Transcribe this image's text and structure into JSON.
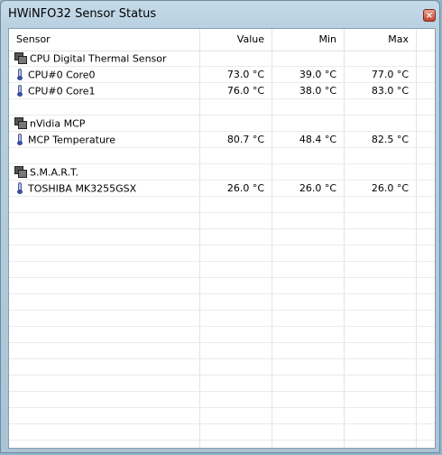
{
  "window": {
    "title": "HWiNFO32 Sensor Status",
    "close_label": "×"
  },
  "table": {
    "columns": {
      "sensor": "Sensor",
      "value": "Value",
      "min": "Min",
      "max": "Max"
    },
    "rows": [
      {
        "kind": "group",
        "label": "CPU Digital Thermal Sensor"
      },
      {
        "kind": "sensor",
        "label": "CPU#0 Core0",
        "value": "73.0 °C",
        "min": "39.0 °C",
        "max": "77.0 °C"
      },
      {
        "kind": "sensor",
        "label": "CPU#0 Core1",
        "value": "76.0 °C",
        "min": "38.0 °C",
        "max": "83.0 °C"
      },
      {
        "kind": "empty"
      },
      {
        "kind": "group",
        "label": "nVidia MCP"
      },
      {
        "kind": "sensor",
        "label": "MCP Temperature",
        "value": "80.7 °C",
        "min": "48.4 °C",
        "max": "82.5 °C"
      },
      {
        "kind": "empty"
      },
      {
        "kind": "group",
        "label": "S.M.A.R.T."
      },
      {
        "kind": "sensor",
        "label": "TOSHIBA MK3255GSX",
        "value": "26.0 °C",
        "min": "26.0 °C",
        "max": "26.0 °C"
      },
      {
        "kind": "empty"
      },
      {
        "kind": "empty"
      },
      {
        "kind": "empty"
      },
      {
        "kind": "empty"
      },
      {
        "kind": "empty"
      },
      {
        "kind": "empty"
      },
      {
        "kind": "empty"
      },
      {
        "kind": "empty"
      },
      {
        "kind": "empty"
      },
      {
        "kind": "empty"
      },
      {
        "kind": "empty"
      },
      {
        "kind": "empty"
      },
      {
        "kind": "empty"
      },
      {
        "kind": "empty"
      },
      {
        "kind": "empty"
      },
      {
        "kind": "empty"
      }
    ]
  },
  "icons": {
    "group": "sensor-group-icon",
    "sensor": "thermometer-icon"
  }
}
